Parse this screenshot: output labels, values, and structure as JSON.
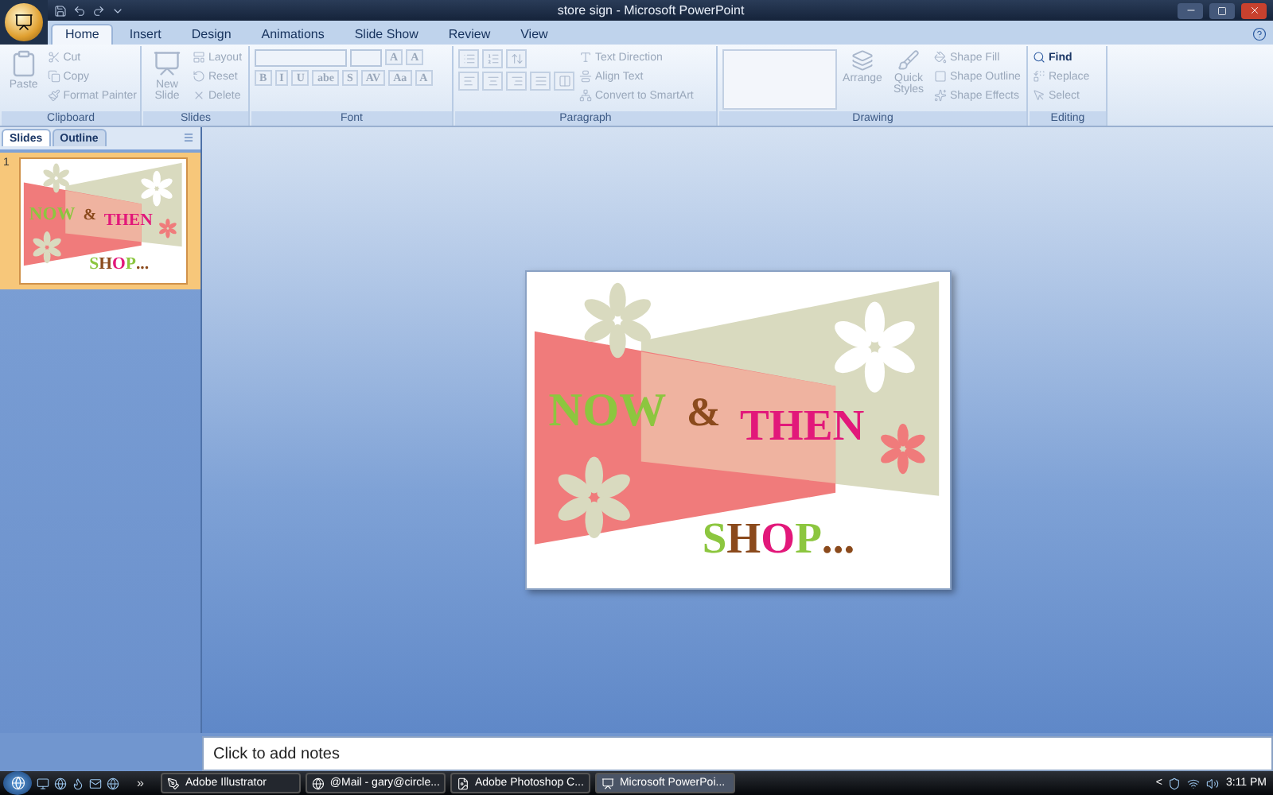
{
  "window": {
    "title": "store sign - Microsoft PowerPoint"
  },
  "tabs": [
    {
      "label": "Home",
      "selected": true
    },
    {
      "label": "Insert",
      "selected": false
    },
    {
      "label": "Design",
      "selected": false
    },
    {
      "label": "Animations",
      "selected": false
    },
    {
      "label": "Slide Show",
      "selected": false
    },
    {
      "label": "Review",
      "selected": false
    },
    {
      "label": "View",
      "selected": false
    }
  ],
  "ribbon": {
    "clipboard": {
      "title": "Clipboard",
      "big": {
        "label": "Paste",
        "disabled": true
      },
      "items": [
        {
          "label": "Cut",
          "disabled": true
        },
        {
          "label": "Copy",
          "disabled": true
        },
        {
          "label": "Format Painter",
          "disabled": true
        }
      ]
    },
    "slides": {
      "title": "Slides",
      "big": {
        "label": "New Slide",
        "disabled": true
      },
      "items": [
        {
          "label": "Layout",
          "disabled": true
        },
        {
          "label": "Reset",
          "disabled": true
        },
        {
          "label": "Delete",
          "disabled": true
        }
      ]
    },
    "font": {
      "title": "Font",
      "size_buttons": [
        "A",
        "A"
      ],
      "format_buttons": [
        "B",
        "I",
        "U",
        "abe",
        "S",
        "AV",
        "Aa",
        "A"
      ]
    },
    "paragraph": {
      "title": "Paragraph",
      "items": [
        {
          "label": "Text Direction",
          "disabled": true
        },
        {
          "label": "Align Text",
          "disabled": true
        },
        {
          "label": "Convert to SmartArt",
          "disabled": true
        }
      ]
    },
    "drawing": {
      "title": "Drawing",
      "big": [
        {
          "label": "Arrange",
          "disabled": true
        },
        {
          "label": "Quick Styles",
          "disabled": true
        }
      ],
      "items": [
        {
          "label": "Shape Fill",
          "disabled": true
        },
        {
          "label": "Shape Outline",
          "disabled": true
        },
        {
          "label": "Shape Effects",
          "disabled": true
        }
      ]
    },
    "editing": {
      "title": "Editing",
      "items": [
        {
          "label": "Find",
          "disabled": false
        },
        {
          "label": "Replace",
          "disabled": true
        },
        {
          "label": "Select",
          "disabled": true
        }
      ]
    }
  },
  "pane_tabs": [
    {
      "label": "Slides",
      "selected": true
    },
    {
      "label": "Outline",
      "selected": false
    }
  ],
  "thumbnail": {
    "number": "1",
    "selected": true,
    "slide": {
      "word_1": {
        "text": "NOW",
        "color": "#8cc63f"
      },
      "word_2": {
        "text": "&",
        "color": "#8b4a1c"
      },
      "word_3": {
        "text": "THEN",
        "color": "#e2187a"
      },
      "shop_letters": [
        {
          "text": "S",
          "color": "#8cc63f"
        },
        {
          "text": "H",
          "color": "#8b4a1c"
        },
        {
          "text": "O",
          "color": "#e2187a"
        },
        {
          "text": "P",
          "color": "#8cc63f"
        },
        {
          "text": "...",
          "color": "#8b4a1c"
        }
      ]
    }
  },
  "slide": {
    "word_1": {
      "text": "NOW",
      "color": "#8cc63f"
    },
    "word_2": {
      "text": "&",
      "color": "#8b4a1c"
    },
    "word_3": {
      "text": "THEN",
      "color": "#e2187a"
    },
    "shop_letters": [
      {
        "text": "S",
        "color": "#8cc63f"
      },
      {
        "text": "H",
        "color": "#8b4a1c"
      },
      {
        "text": "O",
        "color": "#e2187a"
      },
      {
        "text": "P",
        "color": "#8cc63f"
      },
      {
        "text": "...",
        "color": "#8b4a1c"
      }
    ]
  },
  "notes": {
    "placeholder": "Click to add notes"
  },
  "taskbar": {
    "more": "»",
    "items": [
      {
        "label": "Adobe Illustrator",
        "selected": false
      },
      {
        "label": "@Mail - gary@circle...",
        "selected": false
      },
      {
        "label": "Adobe Photoshop C...",
        "selected": false
      },
      {
        "label": "Microsoft PowerPoi...",
        "selected": true
      }
    ],
    "tray_toggle": "<",
    "clock": "3:11 PM"
  }
}
